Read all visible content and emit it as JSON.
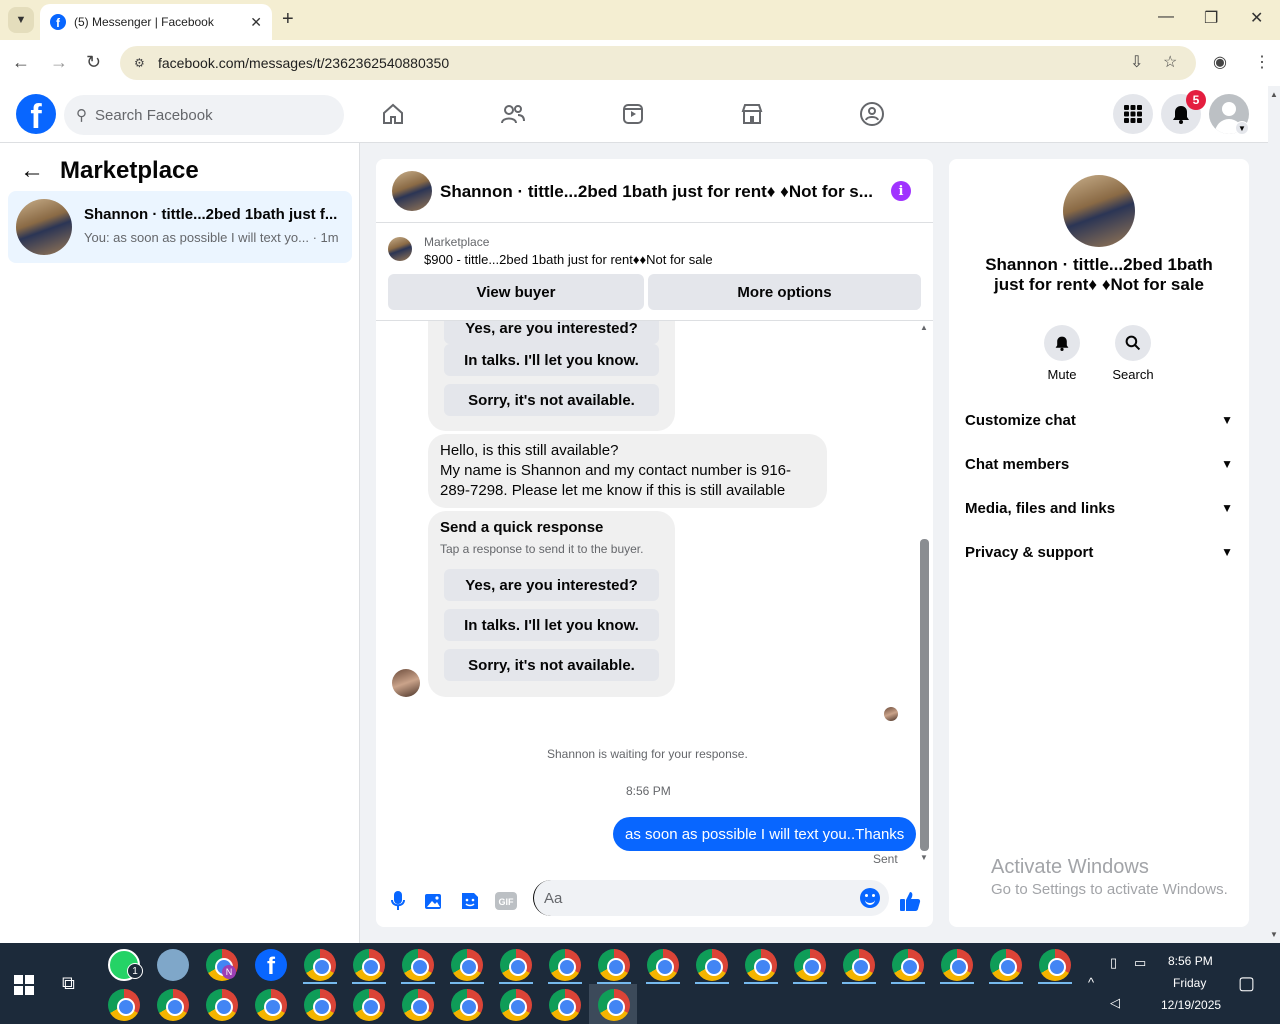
{
  "browser": {
    "tab_title": "(5) Messenger | Facebook",
    "url": "facebook.com/messages/t/2362362540880350",
    "icons": [
      "tab-search-icon",
      "facebook-icon",
      "close-icon",
      "plus-icon",
      "minimize-icon",
      "restore-icon",
      "close-window-icon",
      "back-icon",
      "forward-icon",
      "reload-icon",
      "site-info-icon",
      "install-icon",
      "star-icon",
      "profile-icon",
      "menu-icon"
    ]
  },
  "fb_header": {
    "search_placeholder": "Search Facebook",
    "notification_count": "5",
    "nav_icons": [
      "home-icon",
      "friends-icon",
      "video-icon",
      "marketplace-icon",
      "groups-icon"
    ]
  },
  "sidebar": {
    "title": "Marketplace",
    "conversations": [
      {
        "name": "Shannon · tittle...2bed 1bath just f...",
        "snippet": "You: as soon as possible I will text yo... · 1m"
      }
    ]
  },
  "chat": {
    "header_name": "Shannon · tittle...2bed 1bath just for rent♦ ♦Not for s...",
    "marketplace_label": "Marketplace",
    "listing": "$900 - tittle...2bed 1bath just for rent♦♦Not for sale",
    "view_buyer": "View buyer",
    "more_options": "More options",
    "quick_replies_top": [
      "Yes, are you interested?",
      "In talks. I'll let you know.",
      "Sorry, it's not available."
    ],
    "buyer_message": "Hello, is this still available?\nMy name is Shannon and my contact number is 916-289-7298. Please let me know if this is still available",
    "quick_response_title": "Send a quick response",
    "quick_response_sub": "Tap a response to send it to the buyer.",
    "quick_replies": [
      "Yes, are you interested?",
      "In talks. I'll let you know.",
      "Sorry, it's not available."
    ],
    "waiting": "Shannon is waiting for your response.",
    "timestamp": "8:56 PM",
    "my_message": "as soon as possible I will text you..Thanks",
    "sent_status": "Sent",
    "input_placeholder": "Aa"
  },
  "details": {
    "name": "Shannon · tittle...2bed 1bath just for rent♦ ♦Not for sale",
    "actions": [
      {
        "label": "Mute",
        "icon": "bell-icon"
      },
      {
        "label": "Search",
        "icon": "search-icon"
      }
    ],
    "sections": [
      "Customize chat",
      "Chat members",
      "Media, files and links",
      "Privacy & support"
    ]
  },
  "watermark": {
    "line1": "Activate Windows",
    "line2": "Go to Settings to activate Windows."
  },
  "taskbar": {
    "time": "8:56 PM",
    "day": "Friday",
    "date": "12/19/2025",
    "whatsapp_badge": "1",
    "chrome_n_badge": "N"
  }
}
